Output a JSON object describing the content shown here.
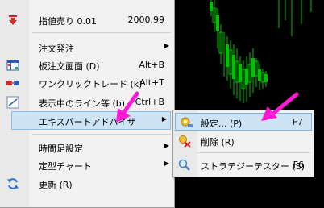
{
  "main_menu": {
    "items": [
      {
        "label": "指値売り 0.01",
        "shortcut": "2000.99",
        "icon": "down-arrow-icon"
      },
      {
        "label": "注文発注",
        "shortcut": "",
        "icon": ""
      },
      {
        "label": "板注文画面 (D)",
        "shortcut": "Alt+B",
        "icon": "grid-icon"
      },
      {
        "label": "ワンクリックトレード (k)",
        "shortcut": "Alt+T",
        "icon": "one-click-icon"
      },
      {
        "label": "表示中のライン等 (b)",
        "shortcut": "Ctrl+B",
        "icon": "line-icon"
      },
      {
        "label": "エキスパートアドバイザ",
        "shortcut": "",
        "icon": ""
      },
      {
        "label": "時間足設定",
        "shortcut": "",
        "icon": ""
      },
      {
        "label": "定型チャート",
        "shortcut": "",
        "icon": ""
      },
      {
        "label": "更新 (R)",
        "shortcut": "",
        "icon": "refresh-icon"
      }
    ]
  },
  "sub_menu": {
    "items": [
      {
        "label": "設定... (P)",
        "shortcut": "F7",
        "icon": "settings-icon"
      },
      {
        "label": "削除 (R)",
        "shortcut": "",
        "icon": "delete-icon"
      },
      {
        "label": "ストラテジーテスター (S)",
        "shortcut": "F6",
        "icon": "tester-icon"
      }
    ]
  },
  "colors": {
    "menu_bg": "#f2f2f2",
    "highlight": "#cde4f7",
    "annotation_arrow": "#ff19d4",
    "chart_candle": "#00d000"
  }
}
